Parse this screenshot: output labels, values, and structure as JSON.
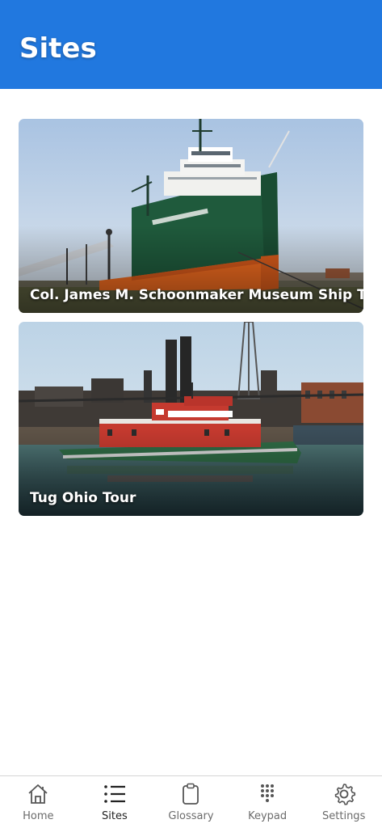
{
  "header": {
    "title": "Sites"
  },
  "sites": [
    {
      "label": "Col. James M. Schoonmaker Museum Ship Tour",
      "image": "freighter-ship-photo"
    },
    {
      "label": "Tug Ohio Tour",
      "image": "red-tugboat-photo"
    }
  ],
  "tabbar": {
    "active": "Sites",
    "tabs": [
      {
        "label": "Home",
        "icon": "home-icon"
      },
      {
        "label": "Sites",
        "icon": "list-icon"
      },
      {
        "label": "Glossary",
        "icon": "clipboard-icon"
      },
      {
        "label": "Keypad",
        "icon": "keypad-icon"
      },
      {
        "label": "Settings",
        "icon": "gear-icon"
      }
    ]
  },
  "colors": {
    "header_bg": "#2178df",
    "tab_active": "#222222",
    "tab_inactive": "#6b6b6b",
    "ship_hull_green": "#1f5a3c",
    "ship_hull_orange": "#ee6a1f",
    "tug_red": "#c53a2f"
  }
}
